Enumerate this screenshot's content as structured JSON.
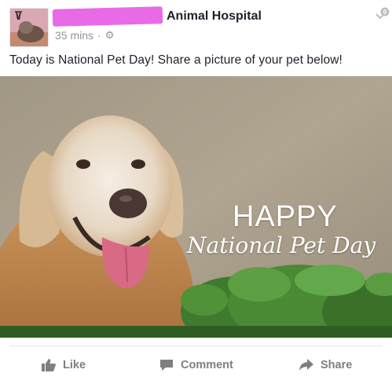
{
  "post": {
    "page_name": "Animal Hospital",
    "time": "35 mins",
    "separator": "·",
    "text": "Today is National Pet Day! Share a picture of your pet below!"
  },
  "image": {
    "headline": "HAPPY",
    "subline": "National Pet Day"
  },
  "actions": {
    "like": "Like",
    "comment": "Comment",
    "share": "Share"
  },
  "icons": {
    "privacy": "gear-icon",
    "menu": "chevron-down-icon",
    "like": "thumbs-up-icon",
    "comment": "speech-bubble-icon",
    "share": "share-arrow-icon"
  }
}
